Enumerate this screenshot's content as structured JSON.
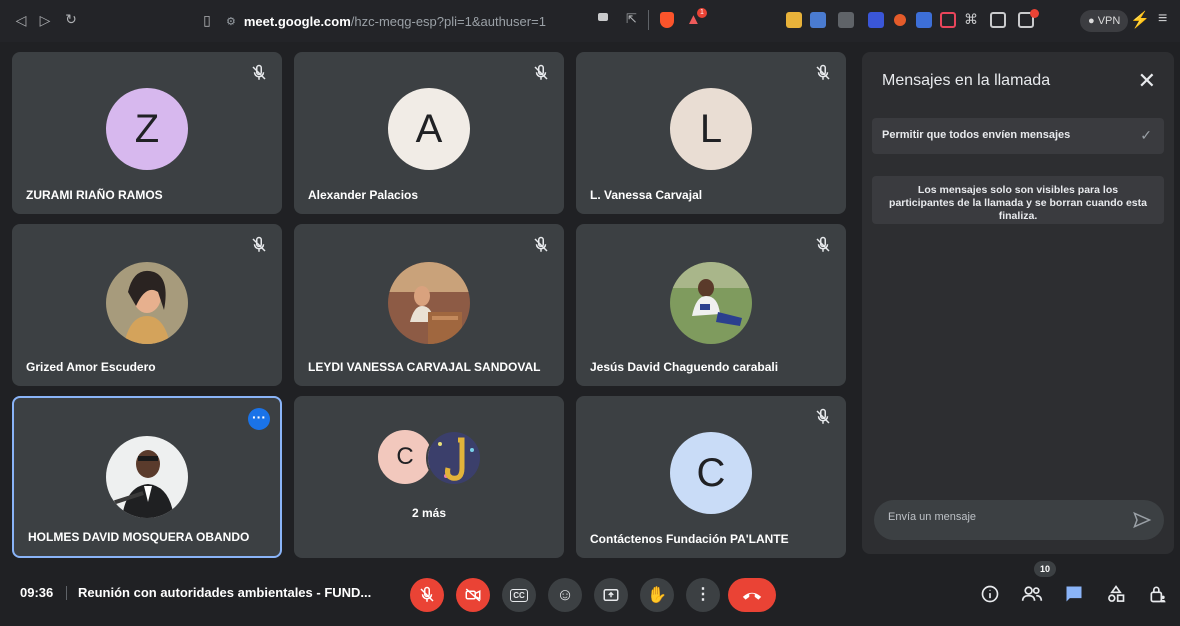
{
  "browser": {
    "url_domain": "meet.google.com",
    "url_path": "/hzc-meqg-esp?pli=1&authuser=1",
    "vpn_label": "VPN",
    "shield_badge": "1"
  },
  "tiles": [
    {
      "name": "ZURAMI RIAÑO RAMOS",
      "initial": "Z",
      "avatar_color": "#d7b8ee",
      "muted": true
    },
    {
      "name": "Alexander Palacios",
      "initial": "A",
      "avatar_color": "#f1ece6",
      "muted": true
    },
    {
      "name": "L. Vanessa Carvajal",
      "initial": "L",
      "avatar_color": "#e9ddd3",
      "muted": true
    },
    {
      "name": "Grized Amor Escudero",
      "photo": "woman-illustration",
      "muted": true
    },
    {
      "name": "LEYDI VANESSA CARVAJAL SANDOVAL",
      "photo": "woman-at-podium",
      "muted": true
    },
    {
      "name": "Jesús David Chaguendo carabali",
      "photo": "man-on-grass",
      "muted": true
    },
    {
      "name": "HOLMES DAVID MOSQUERA OBANDO",
      "photo": "man-in-suit",
      "muted": false
    },
    {
      "more_label": "2 más",
      "initial": "C",
      "avatar_color": "#f2c8bd"
    },
    {
      "name": "Contáctenos Fundación PA'LANTE",
      "initial": "C",
      "avatar_color": "#c9dcf7",
      "muted": true
    }
  ],
  "panel": {
    "title": "Mensajes en la llamada",
    "toggle_label": "Permitir que todos envíen mensajes",
    "info": "Los mensajes solo son visibles para los participantes de la llamada y se borran cuando esta finaliza.",
    "input_placeholder": "Envía un mensaje"
  },
  "controls": {
    "time": "09:36",
    "meeting_title": "Reunión con autoridades ambientales - FUND...",
    "participants_count": "10"
  },
  "colors": {
    "tile_bg": "#3c4043",
    "page_bg": "#202124",
    "accent_blue": "#8ab4f8",
    "red": "#ea4335"
  }
}
